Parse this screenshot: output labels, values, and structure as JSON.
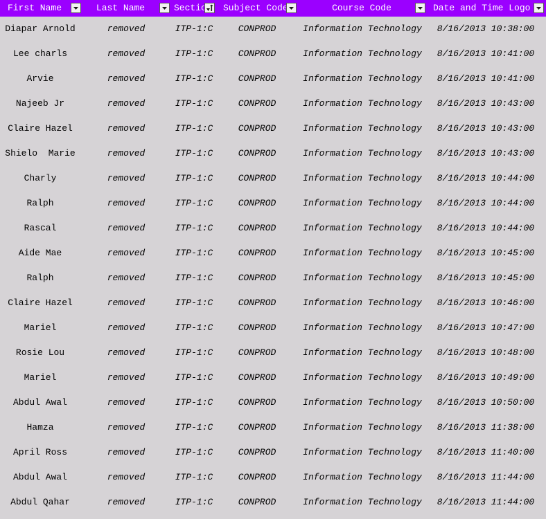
{
  "header": {
    "columns": [
      {
        "label": "First Name",
        "filter_icon": "dropdown-arrow"
      },
      {
        "label": "Last Name",
        "filter_icon": "dropdown-arrow"
      },
      {
        "label": "Sectio",
        "filter_icon": "sort-filter-arrow"
      },
      {
        "label": "Subject Code",
        "filter_icon": "dropdown-arrow"
      },
      {
        "label": "Course Code",
        "filter_icon": "dropdown-arrow"
      },
      {
        "label": "Date and Time Logo",
        "filter_icon": "dropdown-arrow"
      }
    ],
    "background": "#9b00ff",
    "text_color": "#ffffff"
  },
  "rows": [
    {
      "first": "Diapar Arnold",
      "last": "removed",
      "section": "ITP-1:C",
      "subject": "CONPROD",
      "course": "Information Technology",
      "datetime": "8/16/2013 10:38:00"
    },
    {
      "first": "Lee charls",
      "last": "removed",
      "section": "ITP-1:C",
      "subject": "CONPROD",
      "course": "Information Technology",
      "datetime": "8/16/2013 10:41:00"
    },
    {
      "first": "Arvie",
      "last": "removed",
      "section": "ITP-1:C",
      "subject": "CONPROD",
      "course": "Information Technology",
      "datetime": "8/16/2013 10:41:00"
    },
    {
      "first": "Najeeb Jr",
      "last": "removed",
      "section": "ITP-1:C",
      "subject": "CONPROD",
      "course": "Information Technology",
      "datetime": "8/16/2013 10:43:00"
    },
    {
      "first": "Claire Hazel",
      "last": "removed",
      "section": "ITP-1:C",
      "subject": "CONPROD",
      "course": "Information Technology",
      "datetime": "8/16/2013 10:43:00"
    },
    {
      "first": "Shielo  Marie",
      "last": "removed",
      "section": "ITP-1:C",
      "subject": "CONPROD",
      "course": "Information Technology",
      "datetime": "8/16/2013 10:43:00"
    },
    {
      "first": "Charly",
      "last": "removed",
      "section": "ITP-1:C",
      "subject": "CONPROD",
      "course": "Information Technology",
      "datetime": "8/16/2013 10:44:00"
    },
    {
      "first": "Ralph",
      "last": "removed",
      "section": "ITP-1:C",
      "subject": "CONPROD",
      "course": "Information Technology",
      "datetime": "8/16/2013 10:44:00"
    },
    {
      "first": "Rascal",
      "last": "removed",
      "section": "ITP-1:C",
      "subject": "CONPROD",
      "course": "Information Technology",
      "datetime": "8/16/2013 10:44:00"
    },
    {
      "first": "Aide Mae",
      "last": "removed",
      "section": "ITP-1:C",
      "subject": "CONPROD",
      "course": "Information Technology",
      "datetime": "8/16/2013 10:45:00"
    },
    {
      "first": "Ralph",
      "last": "removed",
      "section": "ITP-1:C",
      "subject": "CONPROD",
      "course": "Information Technology",
      "datetime": "8/16/2013 10:45:00"
    },
    {
      "first": "Claire Hazel",
      "last": "removed",
      "section": "ITP-1:C",
      "subject": "CONPROD",
      "course": "Information Technology",
      "datetime": "8/16/2013 10:46:00"
    },
    {
      "first": "Mariel",
      "last": "removed",
      "section": "ITP-1:C",
      "subject": "CONPROD",
      "course": "Information Technology",
      "datetime": "8/16/2013 10:47:00"
    },
    {
      "first": "Rosie Lou",
      "last": "removed",
      "section": "ITP-1:C",
      "subject": "CONPROD",
      "course": "Information Technology",
      "datetime": "8/16/2013 10:48:00"
    },
    {
      "first": "Mariel",
      "last": "removed",
      "section": "ITP-1:C",
      "subject": "CONPROD",
      "course": "Information Technology",
      "datetime": "8/16/2013 10:49:00"
    },
    {
      "first": "Abdul Awal",
      "last": "removed",
      "section": "ITP-1:C",
      "subject": "CONPROD",
      "course": "Information Technology",
      "datetime": "8/16/2013 10:50:00"
    },
    {
      "first": "Hamza",
      "last": "removed",
      "section": "ITP-1:C",
      "subject": "CONPROD",
      "course": "Information Technology",
      "datetime": "8/16/2013 11:38:00"
    },
    {
      "first": "April Ross",
      "last": "removed",
      "section": "ITP-1:C",
      "subject": "CONPROD",
      "course": "Information Technology",
      "datetime": "8/16/2013 11:40:00"
    },
    {
      "first": "Abdul Awal",
      "last": "removed",
      "section": "ITP-1:C",
      "subject": "CONPROD",
      "course": "Information Technology",
      "datetime": "8/16/2013 11:44:00"
    },
    {
      "first": "Abdul Qahar",
      "last": "removed",
      "section": "ITP-1:C",
      "subject": "CONPROD",
      "course": "Information Technology",
      "datetime": "8/16/2013 11:44:00"
    }
  ],
  "colors": {
    "sheet_background": "#d6d3d6",
    "header_background": "#9b00ff"
  }
}
